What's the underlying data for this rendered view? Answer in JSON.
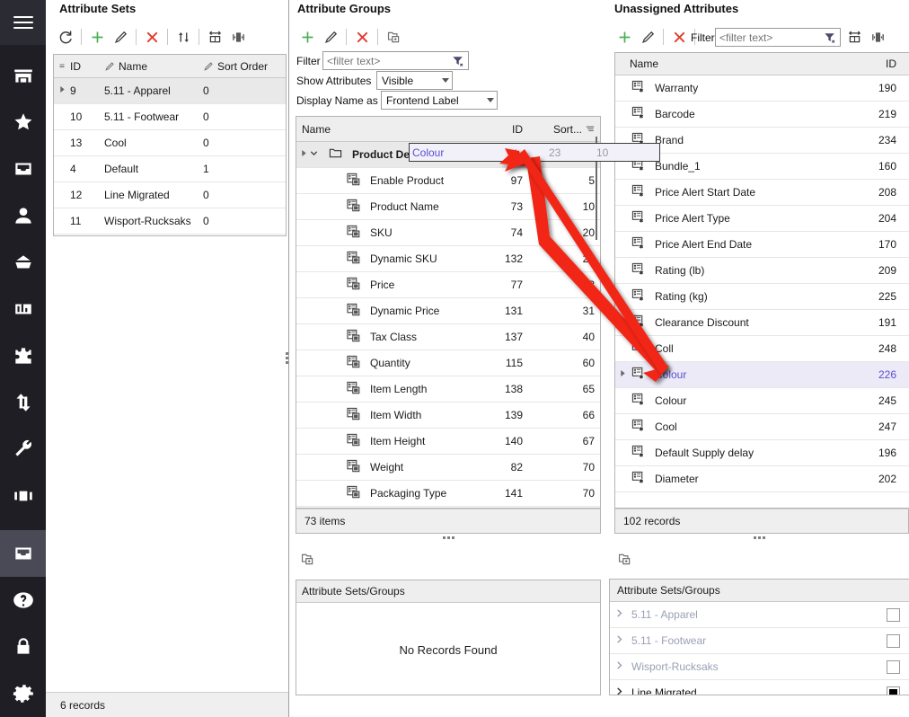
{
  "rail": {
    "menu_icon": "hamburger-menu-icon",
    "items": [
      {
        "icon": "store-icon",
        "name": "store"
      },
      {
        "icon": "star-icon",
        "name": "favourites"
      },
      {
        "icon": "inbox-icon",
        "name": "inbox"
      },
      {
        "icon": "user-icon",
        "name": "customers"
      },
      {
        "icon": "basket-icon",
        "name": "orders"
      },
      {
        "icon": "chart-bar-icon",
        "name": "reports"
      },
      {
        "icon": "puzzle-icon",
        "name": "extensions"
      },
      {
        "icon": "transfer-arrows-icon",
        "name": "sync"
      },
      {
        "icon": "wrench-icon",
        "name": "tools"
      },
      {
        "icon": "panels-icon",
        "name": "layouts"
      }
    ],
    "bottom_items": [
      {
        "icon": "archive-icon",
        "name": "catalog",
        "active": true
      },
      {
        "icon": "help-icon",
        "name": "help"
      },
      {
        "icon": "lock-icon",
        "name": "security"
      },
      {
        "icon": "gear-icon",
        "name": "settings"
      }
    ]
  },
  "left_panel": {
    "title": "Attribute Sets",
    "toolbar": [
      {
        "name": "refresh-button",
        "icon": "refresh-icon"
      },
      {
        "name": "add-button",
        "icon": "plus-icon"
      },
      {
        "name": "edit-button",
        "icon": "pencil-icon"
      },
      {
        "name": "delete-button",
        "icon": "cross-icon"
      },
      {
        "name": "sort-button",
        "icon": "sort-arrows-icon"
      },
      {
        "name": "fit-columns-button",
        "icon": "fit-columns-icon"
      },
      {
        "name": "toggle-panel-button",
        "icon": "split-panel-icon"
      }
    ],
    "columns": [
      "ID",
      "Name",
      "Sort Order"
    ],
    "rows": [
      {
        "id": "9",
        "name": "5.11 - Apparel",
        "sort": "0",
        "selected": true,
        "expandable": true
      },
      {
        "id": "10",
        "name": "5.11 - Footwear",
        "sort": "0",
        "selected": false,
        "expandable": false
      },
      {
        "id": "13",
        "name": "Cool",
        "sort": "0",
        "selected": false,
        "expandable": false
      },
      {
        "id": "4",
        "name": "Default",
        "sort": "1",
        "selected": false,
        "expandable": false
      },
      {
        "id": "12",
        "name": "Line Migrated",
        "sort": "0",
        "selected": false,
        "expandable": false
      },
      {
        "id": "11",
        "name": "Wisport-Rucksaks",
        "sort": "0",
        "selected": false,
        "expandable": false
      }
    ],
    "status": "6 records"
  },
  "middle_panel": {
    "title": "Attribute Groups",
    "toolbar": [
      {
        "name": "add-button",
        "icon": "plus-icon"
      },
      {
        "name": "edit-button",
        "icon": "pencil-icon"
      },
      {
        "name": "delete-button",
        "icon": "cross-icon"
      },
      {
        "name": "copy-button",
        "icon": "copy-folder-icon"
      }
    ],
    "filter_label": "Filter",
    "filter_placeholder": "<filter text>",
    "filter_value": "",
    "show_attributes_label": "Show Attributes",
    "show_attributes_value": "Visible",
    "display_name_label": "Display Name as",
    "display_name_value": "Frontend Label",
    "columns": [
      "Name",
      "ID",
      "Sort..."
    ],
    "group_row": {
      "name": "Product Details",
      "id": "23",
      "sort": "10",
      "expanded": true
    },
    "rows": [
      {
        "name": "Enable Product",
        "id": "97",
        "sort": "5"
      },
      {
        "name": "Product Name",
        "id": "73",
        "sort": "10"
      },
      {
        "name": "SKU",
        "id": "74",
        "sort": "20"
      },
      {
        "name": "Dynamic SKU",
        "id": "132",
        "sort": "21"
      },
      {
        "name": "Price",
        "id": "77",
        "sort": "3"
      },
      {
        "name": "Dynamic Price",
        "id": "131",
        "sort": "31"
      },
      {
        "name": "Tax Class",
        "id": "137",
        "sort": "40"
      },
      {
        "name": "Quantity",
        "id": "115",
        "sort": "60"
      },
      {
        "name": "Item Length",
        "id": "138",
        "sort": "65"
      },
      {
        "name": "Item Width",
        "id": "139",
        "sort": "66"
      },
      {
        "name": "Item Height",
        "id": "140",
        "sort": "67"
      },
      {
        "name": "Weight",
        "id": "82",
        "sort": "70"
      },
      {
        "name": "Packaging Type",
        "id": "141",
        "sort": "70"
      }
    ],
    "status": "73 items"
  },
  "right_panel": {
    "title": "Unassigned Attributes",
    "toolbar": [
      {
        "name": "add-button",
        "icon": "plus-icon"
      },
      {
        "name": "edit-button",
        "icon": "pencil-icon"
      },
      {
        "name": "delete-button",
        "icon": "cross-icon"
      }
    ],
    "filter_label": "Filter",
    "filter_placeholder": "<filter text>",
    "filter_value": "",
    "extra_toolbar": [
      {
        "name": "fit-columns-button",
        "icon": "fit-columns-icon"
      },
      {
        "name": "toggle-panel-button",
        "icon": "split-panel-icon"
      }
    ],
    "columns": [
      "Name",
      "ID"
    ],
    "rows": [
      {
        "name": "Warranty",
        "id": "190",
        "selected": false
      },
      {
        "name": "Barcode",
        "id": "219",
        "selected": false
      },
      {
        "name": "Brand",
        "id": "234",
        "selected": false
      },
      {
        "name": "Bundle_1",
        "id": "160",
        "selected": false
      },
      {
        "name": "Price Alert Start Date",
        "id": "208",
        "selected": false
      },
      {
        "name": "Price Alert Type",
        "id": "204",
        "selected": false
      },
      {
        "name": "Price Alert End Date",
        "id": "170",
        "selected": false
      },
      {
        "name": "Rating (lb)",
        "id": "209",
        "selected": false
      },
      {
        "name": "Rating (kg)",
        "id": "225",
        "selected": false
      },
      {
        "name": "Clearance Discount",
        "id": "191",
        "selected": false
      },
      {
        "name": "Coll",
        "id": "248",
        "selected": false
      },
      {
        "name": "Colour",
        "id": "226",
        "selected": true
      },
      {
        "name": "Colour",
        "id": "245",
        "selected": false
      },
      {
        "name": "Cool",
        "id": "247",
        "selected": false
      },
      {
        "name": "Default Supply delay",
        "id": "196",
        "selected": false
      },
      {
        "name": "Diameter",
        "id": "202",
        "selected": false
      }
    ],
    "status": "102 records"
  },
  "bottom_left_panel": {
    "toolbar_icon": "copy-folder-icon",
    "header": "Attribute Sets/Groups",
    "empty_message": "No Records Found"
  },
  "bottom_right_panel": {
    "toolbar_icon": "copy-folder-icon",
    "header": "Attribute Sets/Groups",
    "rows": [
      {
        "name": "5.11 - Apparel",
        "checked": false,
        "dimmed": true
      },
      {
        "name": "5.11 - Footwear",
        "checked": false,
        "dimmed": true
      },
      {
        "name": "Wisport-Rucksaks",
        "checked": false,
        "dimmed": true
      },
      {
        "name": "Line Migrated",
        "checked": true,
        "dimmed": false
      }
    ]
  },
  "drag_overlay": {
    "label": "Colour",
    "id": "23",
    "sort": "10"
  },
  "colors": {
    "rail_bg": "#1e1e24",
    "rail_active": "#4a4a56",
    "accent_green": "#4caf50",
    "accent_red": "#e23a2e",
    "selection_purple": "#5b4fcf",
    "arrow_red": "#f22613"
  }
}
